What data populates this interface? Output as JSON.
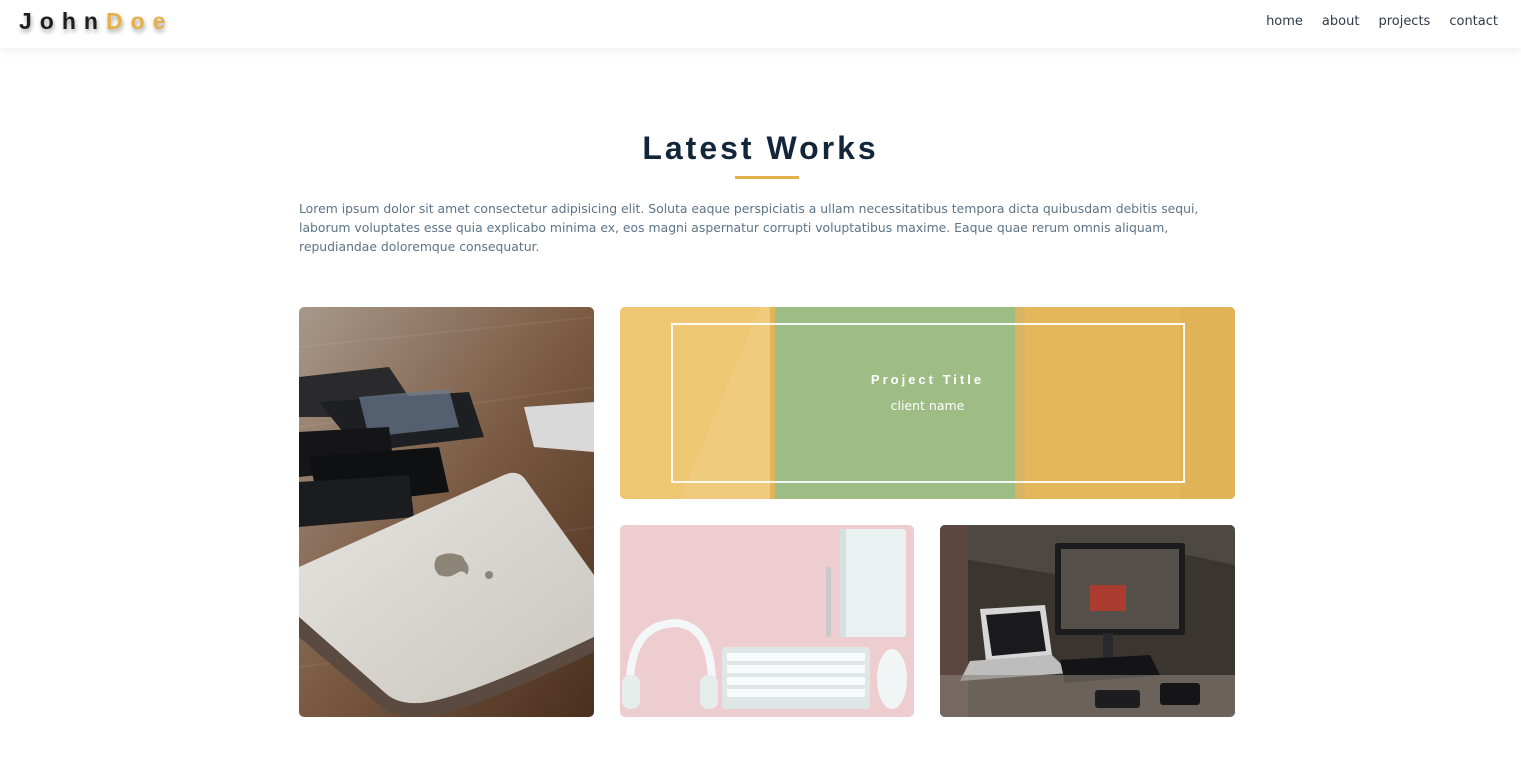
{
  "brand": {
    "first": "John",
    "last": "Doe"
  },
  "nav": {
    "items": [
      {
        "label": "home"
      },
      {
        "label": "about"
      },
      {
        "label": "projects"
      },
      {
        "label": "contact"
      }
    ]
  },
  "section": {
    "title": "Latest Works",
    "intro": "Lorem ipsum dolor sit amet consectetur adipisicing elit. Soluta eaque perspiciatis a ullam necessitatibus tempora dicta quibusdam debitis sequi, laborum voluptates esse quia explicabo minima ex, eos magni aspernatur corrupti voluptatibus maxime. Eaque quae rerum omnis aliquam, repudiandae doloremque consequatur."
  },
  "projects": {
    "featured": {
      "title": "Project Title",
      "client": "client name"
    }
  },
  "colors": {
    "accent": "#e4b04a",
    "heading": "#12263a",
    "body_text": "#5d7387"
  }
}
